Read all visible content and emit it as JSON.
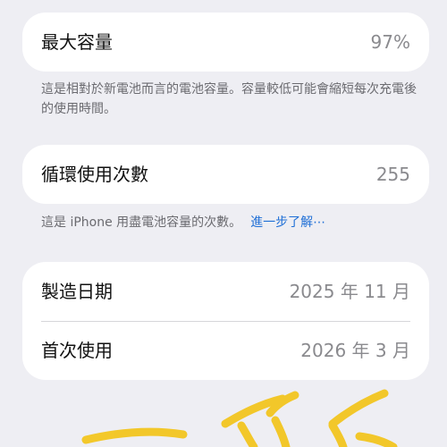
{
  "max_capacity": {
    "label": "最大容量",
    "value": "97%",
    "description": "這是相對於新電池而言的電池容量。容量較低可能會縮短每次充電後的使用時間。"
  },
  "cycle_count": {
    "label": "循環使用次數",
    "value": "255",
    "description": "這是 iPhone 用盡電池容量的次數。",
    "learn_more": "進一步了解⋯"
  },
  "dates": {
    "manufacture_label": "製造日期",
    "manufacture_value": "2025 年 11 月",
    "first_use_label": "首次使用",
    "first_use_value": "2026 年 3 月"
  },
  "colors": {
    "background": "#eeeef3",
    "card": "#ffffff",
    "value_text": "#8a8a8e",
    "link": "#1f6fd6",
    "scribble": "#f3c419"
  }
}
